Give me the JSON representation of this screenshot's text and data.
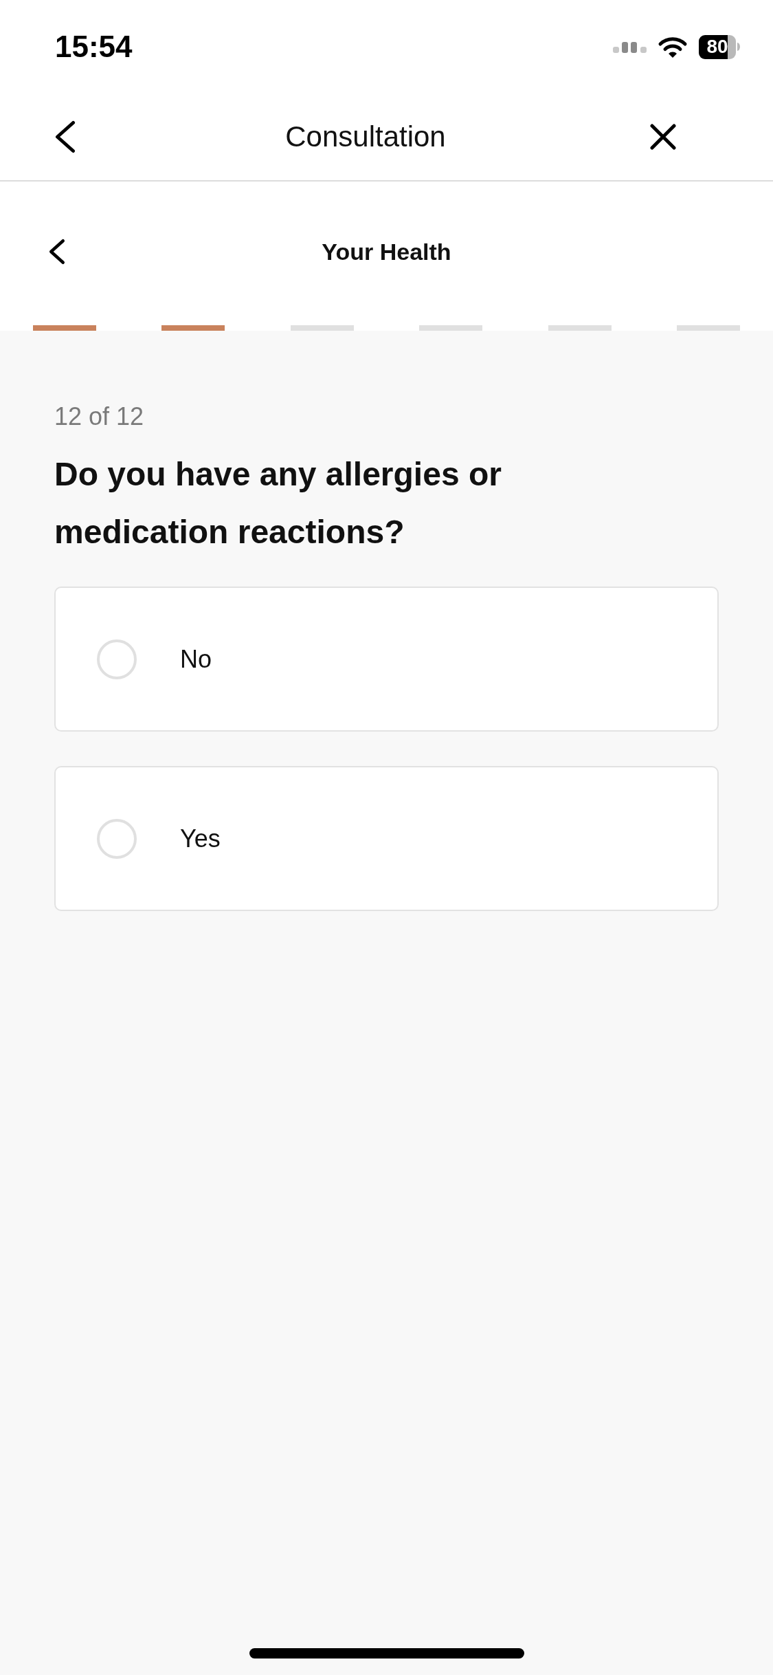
{
  "status_bar": {
    "time": "15:54",
    "battery": "80"
  },
  "header": {
    "title": "Consultation"
  },
  "section": {
    "title": "Your Health",
    "steps": [
      {
        "completed": true
      },
      {
        "completed": true
      },
      {
        "completed": false
      },
      {
        "completed": false
      },
      {
        "completed": false
      },
      {
        "completed": false
      }
    ]
  },
  "question": {
    "counter": "12 of 12",
    "text": "Do you have any allergies or medication reactions?",
    "options": [
      {
        "label": "No",
        "selected": false
      },
      {
        "label": "Yes",
        "selected": false
      }
    ]
  }
}
